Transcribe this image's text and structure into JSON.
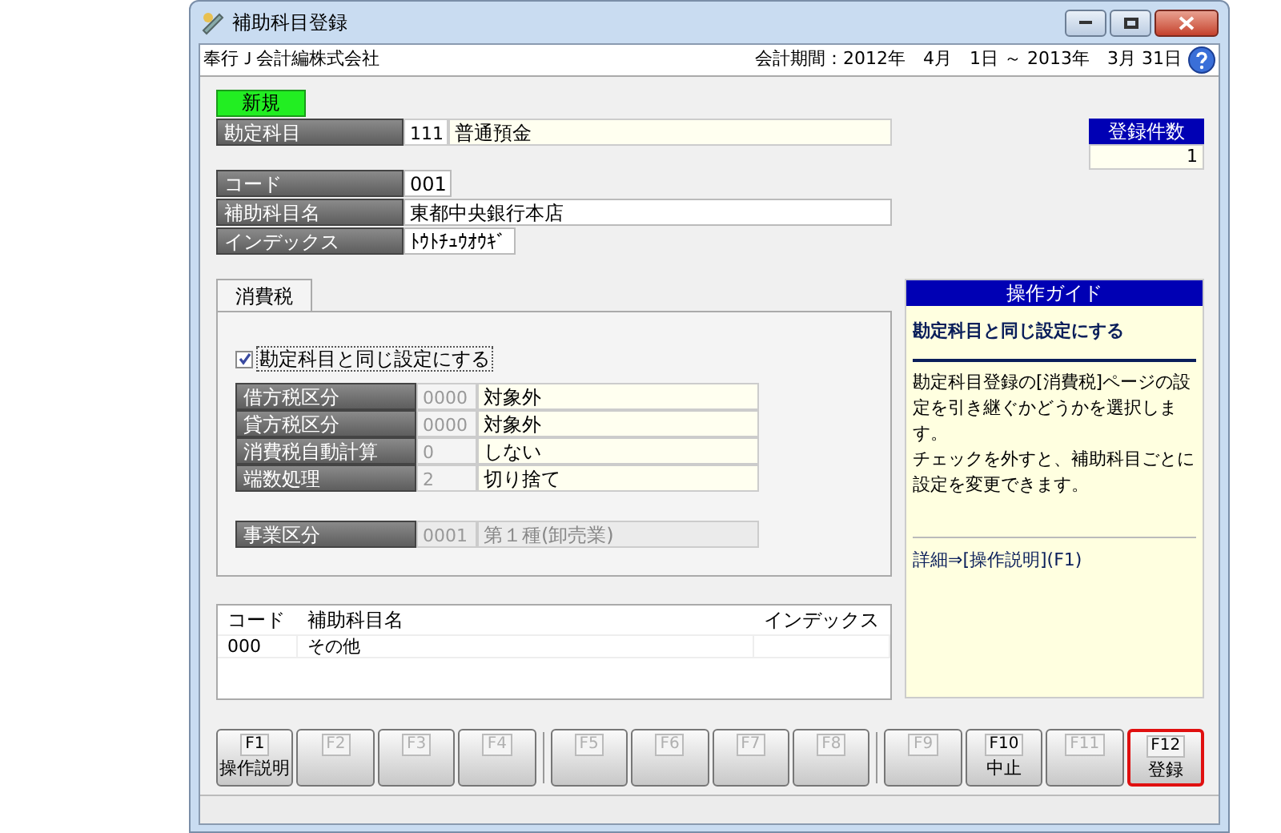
{
  "window": {
    "title": "補助科目登録"
  },
  "header": {
    "company": "奉行Ｊ会計編株式会社",
    "period": "会計期間：2012年　4月　1日 ～ 2013年　3月 31日"
  },
  "mode_badge": "新規",
  "account": {
    "label": "勘定科目",
    "code": "111",
    "name": "普通預金"
  },
  "count": {
    "label": "登録件数",
    "value": "1"
  },
  "fields": [
    {
      "label": "コード",
      "value": "001",
      "kind": "short"
    },
    {
      "label": "補助科目名",
      "value": "東都中央銀行本店",
      "kind": "long"
    },
    {
      "label": "インデックス",
      "value": "ﾄｳﾄﾁｭｳｵｳｷﾞ",
      "kind": "medium"
    }
  ],
  "tabs": [
    {
      "label": "消費税",
      "selected": true
    }
  ],
  "same_setting": {
    "label": "勘定科目と同じ設定にする",
    "checked": true
  },
  "tax_rows": [
    {
      "label": "借方税区分",
      "code": "0000",
      "value": "対象外",
      "disabled": false
    },
    {
      "label": "貸方税区分",
      "code": "0000",
      "value": "対象外",
      "disabled": false
    },
    {
      "label": "消費税自動計算",
      "code": "0",
      "value": "しない",
      "disabled": false
    },
    {
      "label": "端数処理",
      "code": "2",
      "value": "切り捨て",
      "disabled": false
    }
  ],
  "business_row": {
    "label": "事業区分",
    "code": "0001",
    "value": "第１種(卸売業)",
    "disabled": true
  },
  "table": {
    "columns": [
      "コード",
      "補助科目名",
      "インデックス"
    ],
    "rows": [
      [
        "000",
        "その他",
        ""
      ]
    ]
  },
  "guide": {
    "title": "操作ガイド",
    "heading": "勘定科目と同じ設定にする",
    "body": [
      "勘定科目登録の[消費税]ページの設定を引き継ぐかどうかを選択します。",
      "チェックを外すと、補助科目ごとに設定を変更できます。"
    ],
    "link": "詳細⇒[操作説明](F1)"
  },
  "function_keys": [
    {
      "key": "F1",
      "label": "操作説明",
      "disabled": false,
      "focused": false
    },
    {
      "key": "F2",
      "disabled": true,
      "focused": false
    },
    {
      "key": "F3",
      "disabled": true,
      "focused": false
    },
    {
      "key": "F4",
      "disabled": true,
      "focused": false
    },
    {
      "key": "F5",
      "disabled": true,
      "focused": false
    },
    {
      "key": "F6",
      "disabled": true,
      "focused": false
    },
    {
      "key": "F7",
      "disabled": true,
      "focused": false
    },
    {
      "key": "F8",
      "disabled": true,
      "focused": false
    },
    {
      "key": "F9",
      "disabled": true,
      "focused": false
    },
    {
      "key": "F10",
      "label": "中止",
      "disabled": false,
      "focused": false
    },
    {
      "key": "F11",
      "disabled": true,
      "focused": false
    },
    {
      "key": "F12",
      "label": "登録",
      "disabled": false,
      "focused": true
    }
  ]
}
